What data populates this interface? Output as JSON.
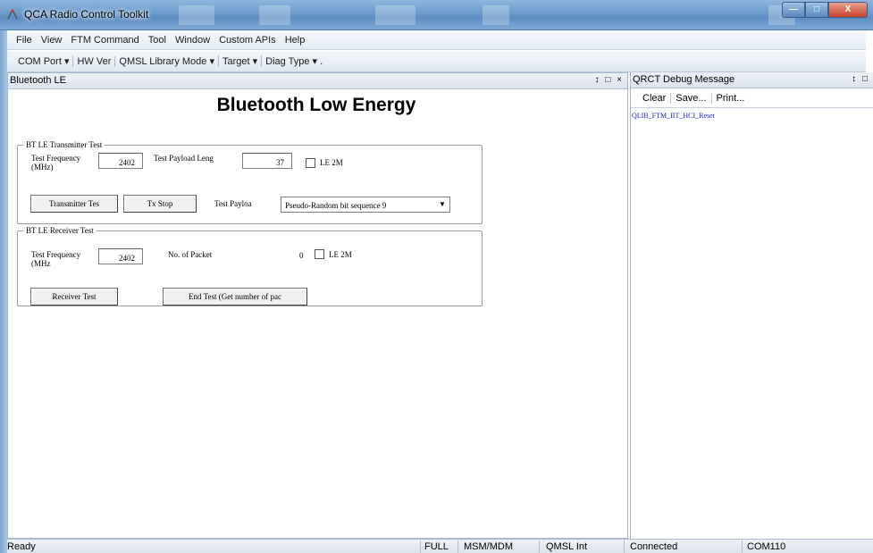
{
  "window": {
    "title": "QCA Radio Control Toolkit"
  },
  "menu": [
    "File",
    "View",
    "FTM Command",
    "Tool",
    "Window",
    "Custom APIs",
    "Help"
  ],
  "toolbar": [
    "COM Port ▾",
    "HW Ver",
    "QMSL Library Mode ▾",
    "Target ▾",
    "Diag Type ▾ ."
  ],
  "left_pane": {
    "title": "Bluetooth LE",
    "controls": "↕ □ ×",
    "heading": "Bluetooth Low Energy",
    "tx": {
      "legend": "BT LE Transmitter Test",
      "freq_label": "Test Frequency (MHz)",
      "freq_value": "2402",
      "payload_len_label": "Test Payload Leng",
      "payload_len_value": "37",
      "le2m_label": "LE 2M",
      "tx_button": "Transmitter Tes",
      "stop_button": "Tx Stop",
      "payload_label": "Test Payloa",
      "payload_value": "Pseudo-Random bit sequence 9"
    },
    "rx": {
      "legend": "BT LE Receiver Test",
      "freq_label": "Test Frequency (MHz",
      "freq_value": "2402",
      "packets_label": "No. of Packet",
      "packets_value": "0",
      "le2m_label": "LE 2M",
      "rx_button": "Receiver Test",
      "end_button": "End Test (Get number of pac"
    }
  },
  "right_pane": {
    "title": "QRCT Debug Message",
    "controls": "↕ □",
    "buttons": [
      "Clear",
      "Save...",
      "Print..."
    ],
    "message": "QLIB_FTM_BT_HCI_Reset"
  },
  "status": {
    "left": "Ready",
    "mode": "FULL",
    "target": "MSM/MDM",
    "lib": "QMSL Int",
    "connection": "Connected",
    "port": "COM110"
  }
}
